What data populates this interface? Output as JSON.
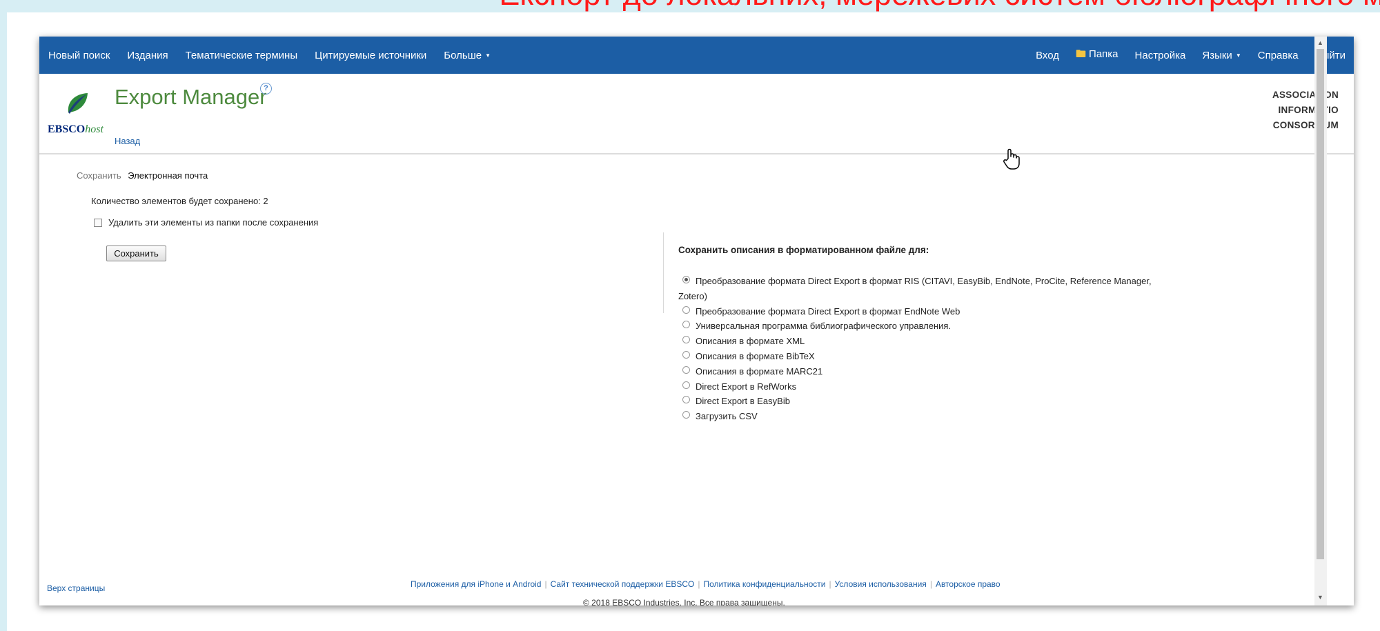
{
  "slide_title": "Експорт до локальних, мережевих систем бібліографічного м",
  "nav": {
    "left": [
      "Новый поиск",
      "Издания",
      "Тематические термины",
      "Цитируемые источники"
    ],
    "more": "Больше",
    "login": "Вход",
    "folder": "Папка",
    "settings": "Настройка",
    "languages": "Языки",
    "help": "Справка",
    "logout": "Выйти"
  },
  "header": {
    "logo_brand": "EBSCO",
    "logo_suffix": "host",
    "title": "Export Manager",
    "help_symbol": "?",
    "back": "Назад",
    "org_lines": [
      "ASSOCIATION",
      "INFORMATIO",
      "CONSORTIUM"
    ]
  },
  "left_panel": {
    "tab_save": "Сохранить",
    "tab_email": "Электронная почта",
    "count_text": "Количество элементов будет сохранено: 2",
    "delete_label": "Удалить эти элементы из папки после сохранения",
    "save_button": "Сохранить"
  },
  "right_panel": {
    "heading": "Сохранить описания в форматированном файле для:",
    "options": [
      {
        "label": "Преобразование формата Direct Export в формат RIS (CITAVI, EasyBib, EndNote, ProCite, Reference Manager, Zotero)",
        "checked": true
      },
      {
        "label": "Преобразование формата Direct Export в формат EndNote Web",
        "checked": false
      },
      {
        "label": "Универсальная программа библиографического управления.",
        "checked": false
      },
      {
        "label": "Описания в формате XML",
        "checked": false
      },
      {
        "label": "Описания в формате BibTeX",
        "checked": false
      },
      {
        "label": "Описания в формате MARC21",
        "checked": false
      },
      {
        "label": "Direct Export в RefWorks",
        "checked": false
      },
      {
        "label": "Direct Export в EasyBib",
        "checked": false
      },
      {
        "label": "Загрузить CSV",
        "checked": false
      }
    ]
  },
  "footer": {
    "top_link": "Верх страницы",
    "links": [
      "Приложения для iPhone и Android",
      "Сайт технической поддержки EBSCO",
      "Политика конфиденциальности",
      "Условия использования",
      "Авторское право"
    ],
    "copyright": "© 2018 EBSCO Industries, Inc. Все права защищены."
  },
  "icons": {
    "folder": "folder-icon",
    "cursor": "hand-pointer-icon",
    "caret": "caret-down-icon"
  },
  "colors": {
    "nav_bg": "#1c5ea5",
    "title_green": "#4d8a3e",
    "slide_title_red": "#ff1a1a",
    "outer_bg": "#d7eef4"
  }
}
